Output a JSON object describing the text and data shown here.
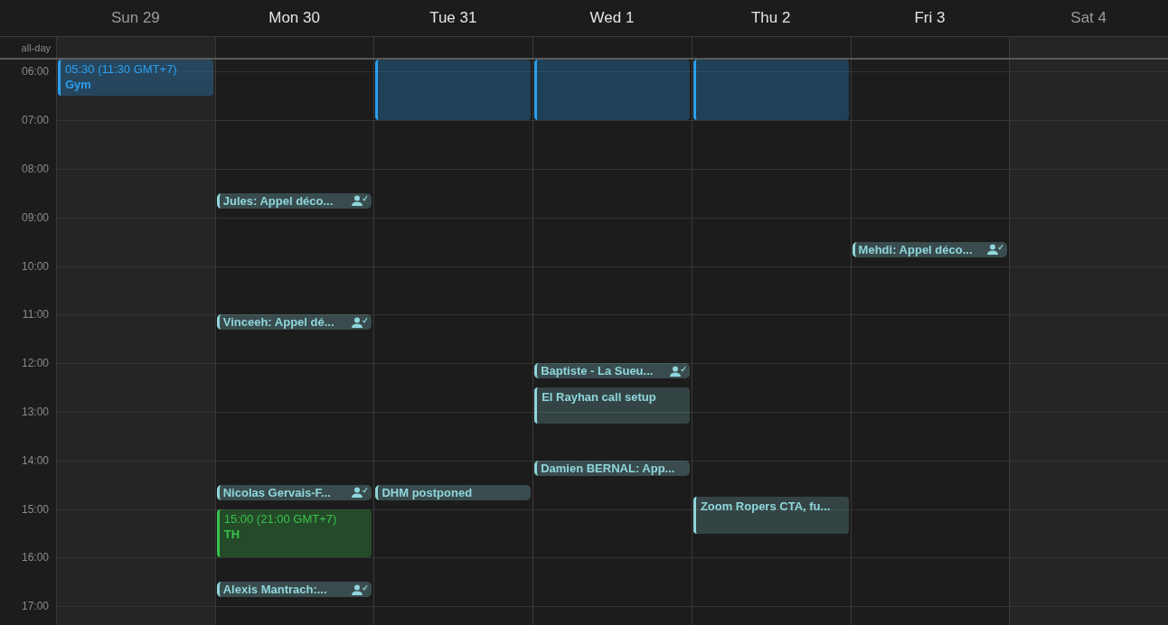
{
  "all_day_label": "all-day",
  "days": [
    {
      "label": "Sun 29",
      "weekend": true,
      "events": [
        {
          "kind": "block",
          "color": "#2a9ff0",
          "time": "05:30 (11:30 GMT+7)",
          "title": "Gym"
        }
      ]
    },
    {
      "label": "Mon 30",
      "weekend": false,
      "events": [
        {
          "kind": "chip",
          "color": "#8fd6dc",
          "title": "Jules: Appel déco...",
          "attendee": true
        },
        {
          "kind": "chip",
          "color": "#8fd6dc",
          "title": "Vinceeh: Appel dé...",
          "attendee": true
        },
        {
          "kind": "chip",
          "color": "#8fd6dc",
          "title": "Nicolas Gervais-F...",
          "attendee": true
        },
        {
          "kind": "block",
          "color": "#38c24a",
          "time": "15:00 (21:00 GMT+7)",
          "title": "TH"
        },
        {
          "kind": "chip",
          "color": "#8fd6dc",
          "title": "Alexis Mantrach:...",
          "attendee": true
        }
      ]
    },
    {
      "label": "Tue 31",
      "weekend": false,
      "events": [
        {
          "kind": "block",
          "color": "#2a9ff0"
        },
        {
          "kind": "chip",
          "color": "#8fd6dc",
          "title": "DHM postponed",
          "attendee": false
        }
      ]
    },
    {
      "label": "Wed 1",
      "weekend": false,
      "events": [
        {
          "kind": "block",
          "color": "#2a9ff0"
        },
        {
          "kind": "chip",
          "color": "#8fd6dc",
          "title": "Baptiste - La Sueu...",
          "attendee": true
        },
        {
          "kind": "block",
          "color": "#8fd6dc",
          "title": "El Rayhan call setup"
        },
        {
          "kind": "chip",
          "color": "#8fd6dc",
          "title": "Damien BERNAL: App...",
          "attendee": false
        }
      ]
    },
    {
      "label": "Thu 2",
      "weekend": false,
      "events": [
        {
          "kind": "block",
          "color": "#2a9ff0"
        },
        {
          "kind": "block",
          "color": "#8fd6dc",
          "title": "Zoom Ropers CTA, fu..."
        }
      ]
    },
    {
      "label": "Fri 3",
      "weekend": false,
      "events": [
        {
          "kind": "chip",
          "color": "#8fd6dc",
          "title": "Mehdi: Appel déco...",
          "attendee": true
        }
      ]
    },
    {
      "label": "Sat 4",
      "weekend": true
    }
  ],
  "hours": [
    "06:00",
    "07:00",
    "08:00",
    "09:00",
    "10:00",
    "11:00",
    "12:00",
    "13:00",
    "14:00",
    "15:00",
    "16:00",
    "17:00"
  ]
}
